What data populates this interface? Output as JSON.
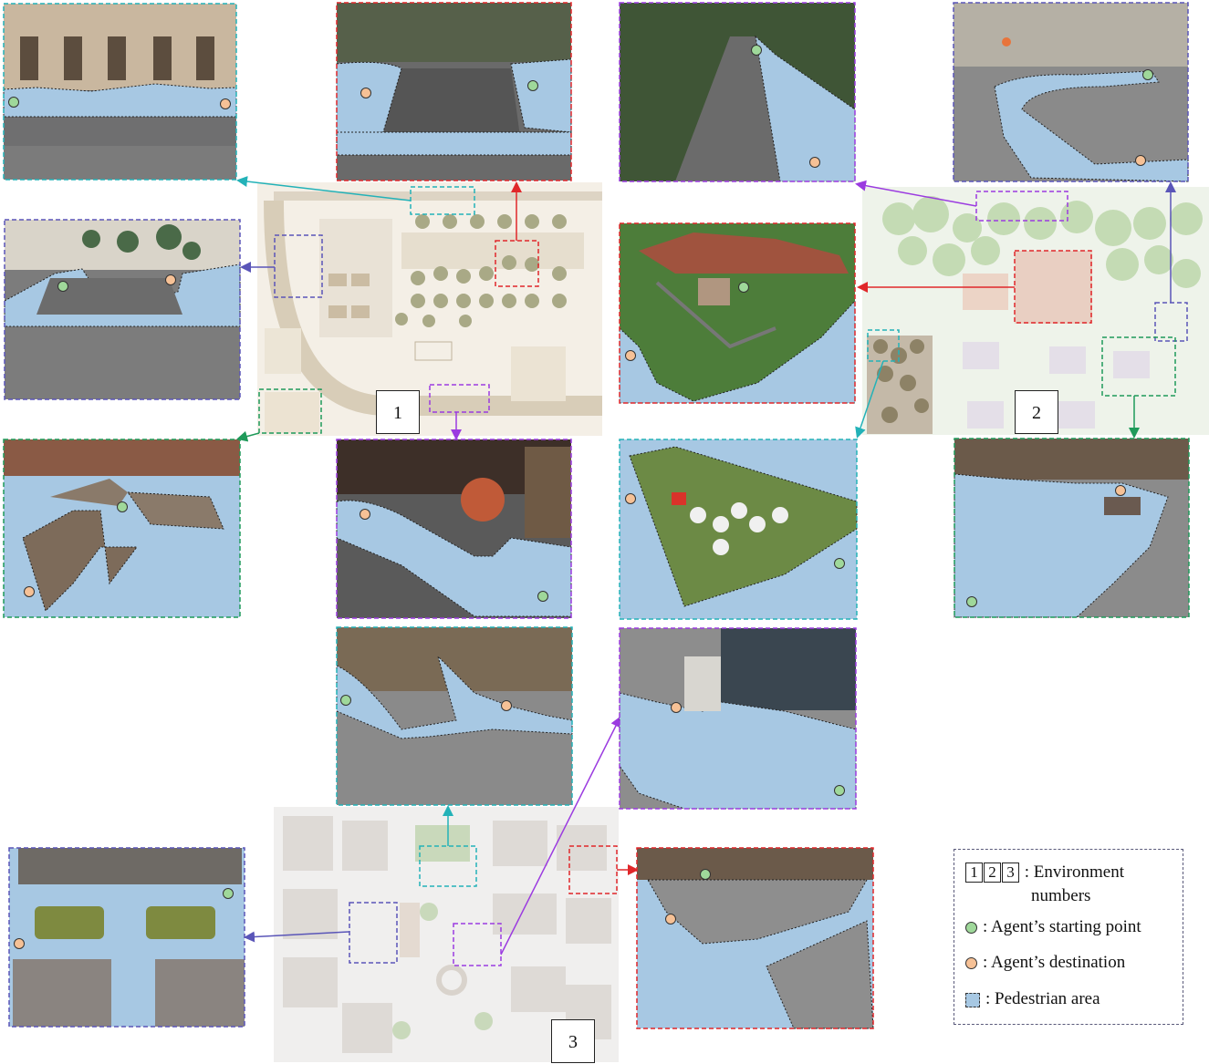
{
  "colors": {
    "pedestrian": "#a7c8e3",
    "start": "#9fd89a",
    "destination": "#f6c196",
    "cyan": "#23b2b8",
    "red": "#e0272a",
    "purple": "#9b3be0",
    "indigo": "#5a55b8",
    "green": "#1f9a5a"
  },
  "environments": [
    {
      "number": "1"
    },
    {
      "number": "2"
    },
    {
      "number": "3"
    }
  ],
  "legend": {
    "env_numbers": [
      "1",
      "2",
      "3"
    ],
    "env_label_line1": ": Environment",
    "env_label_line2": "numbers",
    "start_label": ": Agent’s starting point",
    "destination_label": ": Agent’s destination",
    "pedestrian_label": ": Pedestrian area"
  },
  "scenes": [
    {
      "id": "e1-plaza-facade",
      "env": "1",
      "frame": "cyan"
    },
    {
      "id": "e1-parking-lot",
      "env": "1",
      "frame": "red"
    },
    {
      "id": "e1-palm-street",
      "env": "1",
      "frame": "indigo"
    },
    {
      "id": "e1-rooftops",
      "env": "1",
      "frame": "green"
    },
    {
      "id": "e1-times-square-station",
      "env": "1",
      "frame": "purple"
    },
    {
      "id": "e2-forest-road",
      "env": "2",
      "frame": "purple"
    },
    {
      "id": "e2-fenced-sidewalk",
      "env": "2",
      "frame": "indigo"
    },
    {
      "id": "e2-farmhouse",
      "env": "2",
      "frame": "red"
    },
    {
      "id": "e2-cafe-garden",
      "env": "2",
      "frame": "cyan"
    },
    {
      "id": "e2-parking-garage",
      "env": "2",
      "frame": "green"
    },
    {
      "id": "e3-street-corner",
      "env": "3",
      "frame": "cyan"
    },
    {
      "id": "e3-glass-building",
      "env": "3",
      "frame": "purple"
    },
    {
      "id": "e3-open-lot",
      "env": "3",
      "frame": "red"
    },
    {
      "id": "e3-courtyard",
      "env": "3",
      "frame": "indigo"
    }
  ]
}
